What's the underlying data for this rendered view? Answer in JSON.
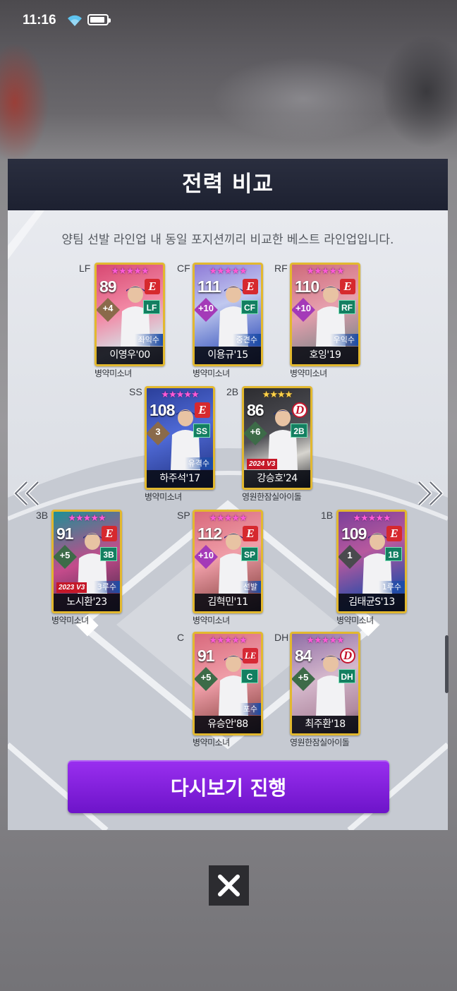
{
  "status_bar": {
    "time": "11:16",
    "battery_level": 0.9
  },
  "dialog": {
    "title": "전력 비교",
    "subtitle": "양팀 선발 라인업 내 동일 포지션끼리 비교한 베스트 라인업입니다.",
    "replay_label": "다시보기 진행",
    "close_icon": "close-icon",
    "prev_icon": "double-chevron-left-icon",
    "next_icon": "double-chevron-right-icon"
  },
  "lineup": [
    {
      "pos": "LF",
      "stars": "★★★★★",
      "rating": "89",
      "boost": "+4",
      "team": "E",
      "role": "좌익수",
      "year": "",
      "name": "이영우'00",
      "owner": "병약미소녀"
    },
    {
      "pos": "CF",
      "stars": "★★★★★",
      "rating": "111",
      "boost": "+10",
      "team": "E",
      "role": "중견수",
      "year": "",
      "name": "이용규'15",
      "owner": "병약미소녀"
    },
    {
      "pos": "RF",
      "stars": "★★★★★",
      "rating": "110",
      "boost": "+10",
      "team": "E",
      "role": "우익수",
      "year": "",
      "name": "호잉'19",
      "owner": "병약미소녀"
    },
    {
      "pos": "SS",
      "stars": "★★★★★",
      "rating": "108",
      "boost": "3",
      "team": "E",
      "role": "유격수",
      "year": "",
      "name": "하주석'17",
      "owner": "병약미소녀"
    },
    {
      "pos": "2B",
      "stars": "★★★★",
      "rating": "86",
      "boost": "+6",
      "team": "D",
      "role": "",
      "year": "2024 V3",
      "name": "강승호'24",
      "owner": "영원한잠실아이돌"
    },
    {
      "pos": "3B",
      "stars": "★★★★★",
      "rating": "91",
      "boost": "+5",
      "team": "E",
      "role": "3루수",
      "year": "2023 V3",
      "name": "노시환'23",
      "owner": "병약미소녀"
    },
    {
      "pos": "SP",
      "stars": "★★★★★",
      "rating": "112",
      "boost": "+10",
      "team": "E",
      "role": "선발",
      "year": "",
      "name": "김혁민'11",
      "owner": "병약미소녀"
    },
    {
      "pos": "1B",
      "stars": "★★★★★",
      "rating": "109",
      "boost": "1",
      "team": "E",
      "role": "1루수",
      "year": "",
      "name": "김태균S'13",
      "owner": "병약미소녀"
    },
    {
      "pos": "C",
      "stars": "★★★★★",
      "rating": "91",
      "boost": "+5",
      "team": "LE",
      "role": "포수",
      "year": "",
      "name": "유승안'88",
      "owner": "병약미소녀"
    },
    {
      "pos": "DH",
      "stars": "★★★★★",
      "rating": "84",
      "boost": "+5",
      "team": "D",
      "role": "",
      "year": "",
      "name": "최주환'18",
      "owner": "영원한잠실아이돌"
    }
  ]
}
